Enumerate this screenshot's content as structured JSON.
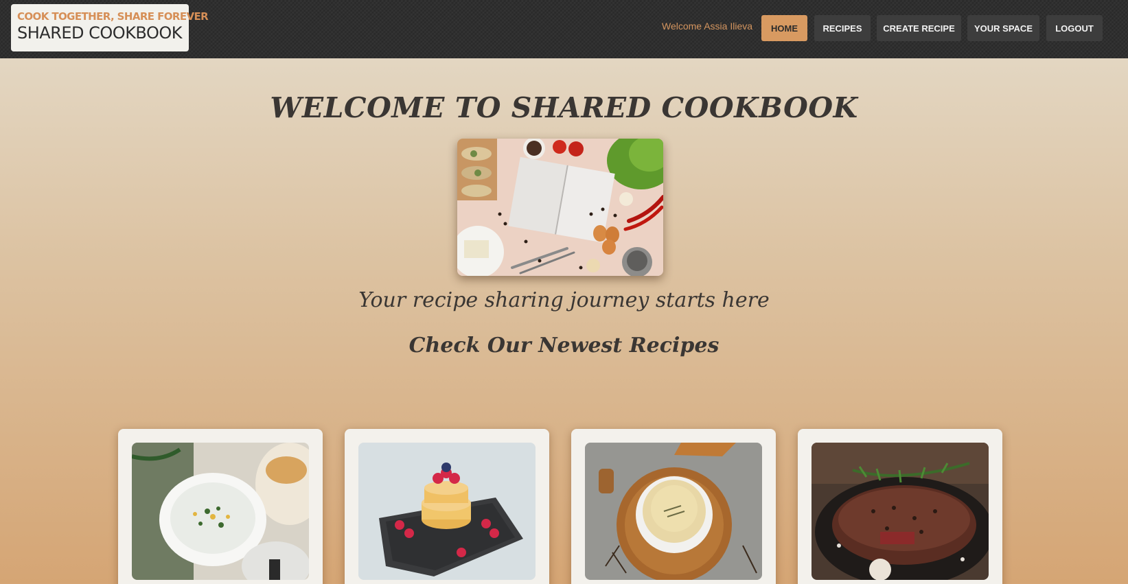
{
  "header": {
    "logo": {
      "tagline": "COOK TOGETHER, SHARE FOREVER",
      "title": "SHARED COOKBOOK"
    },
    "welcome": "Welcome Assia Ilieva",
    "nav": [
      {
        "label": "HOME",
        "active": true
      },
      {
        "label": "RECIPES",
        "active": false
      },
      {
        "label": "CREATE RECIPE",
        "active": false
      },
      {
        "label": "YOUR SPACE",
        "active": false
      },
      {
        "label": "LOGOUT",
        "active": false
      }
    ]
  },
  "hero": {
    "title": "WELCOME TO SHARED COOKBOOK",
    "image": "open-notebook-with-vegetables-photo",
    "subtitle": "Your recipe sharing journey starts here"
  },
  "newest": {
    "title": "Check Our Newest Recipes",
    "recipes": [
      {
        "image": "yogurt-soup-with-dill-photo"
      },
      {
        "image": "pancake-stack-with-raspberries-photo"
      },
      {
        "image": "creamy-soup-bowl-on-board-photo"
      },
      {
        "image": "grilled-steak-with-rosemary-photo"
      }
    ]
  },
  "colors": {
    "header_bg": "#2f2f2f",
    "accent": "#d89a61",
    "nav_bg": "#3d3d3d",
    "card_bg": "#f3f1ec",
    "text_dark": "#3a3633"
  }
}
